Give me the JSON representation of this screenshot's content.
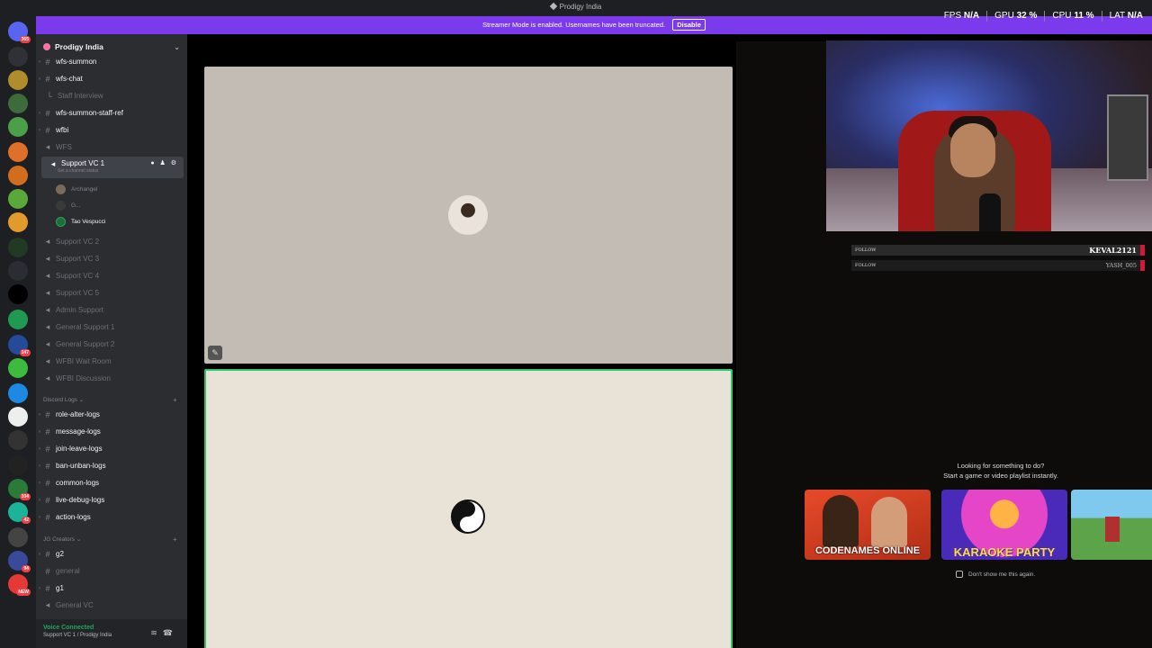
{
  "titlebar": {
    "title": "Prodigy India"
  },
  "banner": {
    "text": "Streamer Mode is enabled. Usernames have been truncated.",
    "disable_label": "Disable"
  },
  "stats": {
    "fps_label": "FPS",
    "fps_value": "N/A",
    "gpu_label": "GPU",
    "gpu_value": "32 %",
    "cpu_label": "CPU",
    "cpu_value": "11 %",
    "lat_label": "LAT",
    "lat_value": "N/A"
  },
  "rail": {
    "home_badge": "365",
    "badges": [
      "147",
      "104",
      "42",
      "94",
      "NEW"
    ]
  },
  "server": {
    "name": "Prodigy India"
  },
  "channels": {
    "wfs_summon": "wfs-summon",
    "wfs_chat": "wfs-chat",
    "staff_interview": "Staff Interview",
    "wfs_summon_staff_ref": "wfs-summon-staff-ref",
    "wfbi": "wfbi",
    "wfs": "WFS",
    "support_vc1": "Support VC 1",
    "support_vc1_status": "Set a channel status",
    "voice_users": [
      "Archangel",
      "G...",
      "Tao Vespucci"
    ],
    "support_vc2": "Support VC 2",
    "support_vc3": "Support VC 3",
    "support_vc4": "Support VC 4",
    "support_vc5": "Support VC 5",
    "admin_support": "Admin Support",
    "general_support1": "General Support 1",
    "general_support2": "General Support 2",
    "wfbi_wait": "WFBI Wait Room",
    "wfbi_discussion": "WFBI Discussion",
    "cat_discord_logs": "Discord Logs",
    "role_alter_logs": "role-alter-logs",
    "message_logs": "message-logs",
    "join_leave_logs": "join-leave-logs",
    "ban_unban_logs": "ban-unban-logs",
    "common_logs": "common-logs",
    "live_debug_logs": "live-debug-logs",
    "action_logs": "action-logs",
    "cat_jg_creators": "JG Creators",
    "g2": "g2",
    "general": "general",
    "g1": "g1",
    "general_vc": "General VC"
  },
  "voice_status": {
    "connected": "Voice Connected",
    "location": "Support VC 1 / Prodigy India"
  },
  "alerts": [
    {
      "label": "FOLLOW",
      "name": "KEVAL2121"
    },
    {
      "label": "FOLLOW",
      "name": "YASH_005"
    }
  ],
  "activity": {
    "line1": "Looking for something to do?",
    "line2": "Start a game or video playlist instantly.",
    "cards": [
      "CODENAMES ONLINE",
      "KARAOKE PARTY",
      ""
    ],
    "dont_show": "Don't show me this again."
  },
  "colors": {
    "accent": "#7c3aed",
    "speaking": "#2dc770",
    "alert": "#d4183d"
  }
}
